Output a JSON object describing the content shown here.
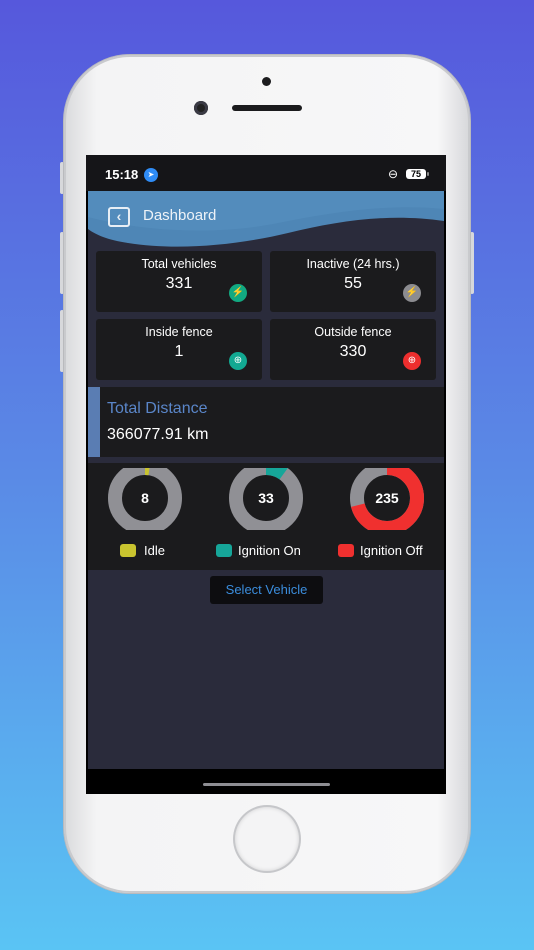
{
  "status_bar": {
    "time": "15:18",
    "battery": "75"
  },
  "header": {
    "title": "Dashboard"
  },
  "cards": [
    {
      "label": "Total vehicles",
      "value": "331",
      "badge_color": "#12a981",
      "icon": "bolt-icon"
    },
    {
      "label": "Inactive (24 hrs.)",
      "value": "55",
      "badge_color": "#8c8c90",
      "icon": "bolt-icon"
    },
    {
      "label": "Inside fence",
      "value": "1",
      "badge_color": "#12a992",
      "icon": "globe-icon"
    },
    {
      "label": "Outside fence",
      "value": "330",
      "badge_color": "#ee2e2e",
      "icon": "globe-icon"
    }
  ],
  "distance": {
    "title": "Total Distance",
    "value": "366077.91 km"
  },
  "gauges": [
    {
      "label": "Idle",
      "value": "8",
      "fraction": 0.024,
      "color": "#c9c42f"
    },
    {
      "label": "Ignition On",
      "value": "33",
      "fraction": 0.1,
      "color": "#16a699"
    },
    {
      "label": "Ignition Off",
      "value": "235",
      "fraction": 0.71,
      "color": "#f0302f"
    }
  ],
  "gauge_track_color": "#909095",
  "select_button": {
    "label": "Select Vehicle"
  }
}
